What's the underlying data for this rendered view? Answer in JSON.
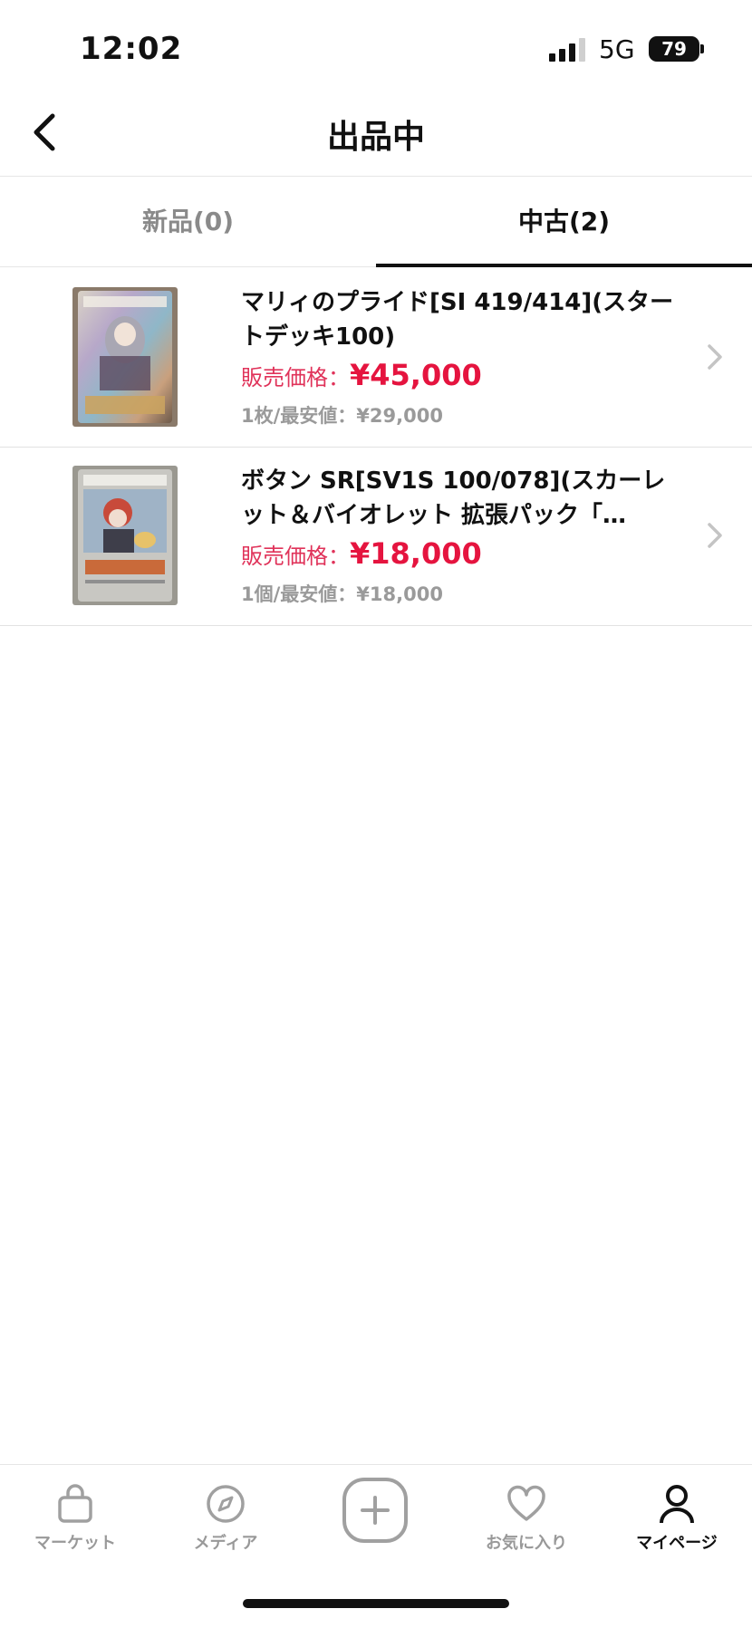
{
  "status_bar": {
    "time": "12:02",
    "network": "5G",
    "battery": "79"
  },
  "header": {
    "title": "出品中",
    "back_icon": "chevron-left-icon"
  },
  "tabs": [
    {
      "label": "新品(0)",
      "active": false
    },
    {
      "label": "中古(2)",
      "active": true
    }
  ],
  "listings": [
    {
      "title": "マリィのプライド[SI 419/414](スタートデッキ100)",
      "price_label": "販売価格：",
      "price": "¥45,000",
      "lowest": "1枚/最安値：¥29,000"
    },
    {
      "title": "ボタン SR[SV1S 100/078](スカーレット＆バイオレット 拡張パック「…",
      "price_label": "販売価格：",
      "price": "¥18,000",
      "lowest": "1個/最安値：¥18,000"
    }
  ],
  "tab_bar": [
    {
      "label": "マーケット",
      "icon": "shopping-bag-icon",
      "active": false
    },
    {
      "label": "メディア",
      "icon": "compass-icon",
      "active": false
    },
    {
      "label": "",
      "icon": "plus-icon",
      "active": false
    },
    {
      "label": "お気に入り",
      "icon": "heart-icon",
      "active": false
    },
    {
      "label": "マイページ",
      "icon": "person-icon",
      "active": true
    }
  ],
  "colors": {
    "price": "#e5143f",
    "muted": "#9a9a9a",
    "active": "#111111"
  }
}
